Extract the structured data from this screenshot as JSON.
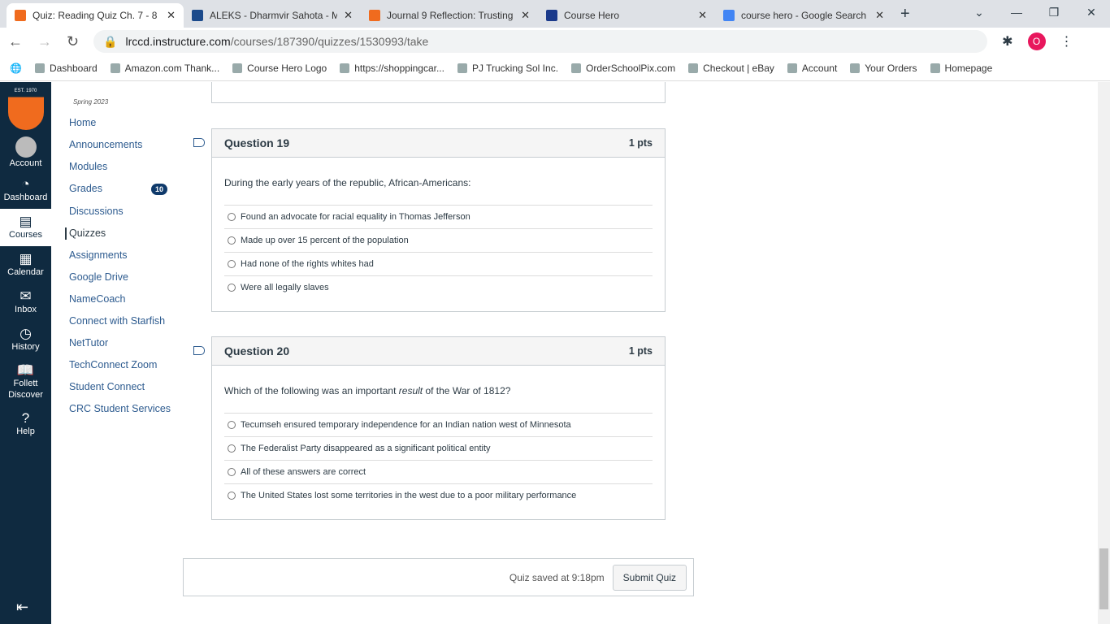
{
  "browser": {
    "tabs": [
      {
        "title": "Quiz: Reading Quiz Ch. 7 - 8",
        "color": "#f06b1e",
        "active": true
      },
      {
        "title": "ALEKS - Dharmvir Sahota - M",
        "color": "#1b4a8b"
      },
      {
        "title": "Journal 9 Reflection: Trusting",
        "color": "#f06b1e"
      },
      {
        "title": "Course Hero",
        "color": "#1b3a8b"
      },
      {
        "title": "course hero - Google Search",
        "color": "#4285f4"
      }
    ],
    "url_host": "lrccd.instructure.com",
    "url_path": "/courses/187390/quizzes/1530993/take",
    "profile": "O",
    "bookmarks": [
      "Dashboard",
      "Amazon.com Thank...",
      "Course Hero Logo",
      "https://shoppingcar...",
      "PJ Trucking Sol Inc.",
      "OrderSchoolPix.com",
      "Checkout | eBay",
      "Account",
      "Your Orders",
      "Homepage"
    ]
  },
  "global_nav": {
    "logo_text": "EST. 1970",
    "items": [
      "Account",
      "Dashboard",
      "Courses",
      "Calendar",
      "Inbox",
      "History",
      "Follett Discover",
      "Help"
    ]
  },
  "course_nav": {
    "term": "Spring 2023",
    "items": [
      "Home",
      "Announcements",
      "Modules",
      "Grades",
      "Discussions",
      "Quizzes",
      "Assignments",
      "Google Drive",
      "NameCoach",
      "Connect with Starfish",
      "NetTutor",
      "TechConnect Zoom",
      "Student Connect",
      "CRC Student Services"
    ],
    "grades_badge": "10",
    "current": "Quizzes"
  },
  "questions": [
    {
      "title": "Question 19",
      "points": "1 pts",
      "text": "During the early years of the republic, African-Americans:",
      "answers": [
        "Found an advocate for racial equality in Thomas Jefferson",
        "Made up over 15 percent of the population",
        "Had none of the rights whites had",
        "Were all legally slaves"
      ]
    },
    {
      "title": "Question 20",
      "points": "1 pts",
      "text_before": "Which of the following was an important ",
      "text_em": "result",
      "text_after": " of the War of 1812?",
      "answers": [
        "Tecumseh ensured temporary independence for an Indian nation west of Minnesota",
        "The Federalist Party disappeared as a significant political entity",
        "All of these answers are correct",
        "The United States lost some territories in the west due to a poor military performance"
      ]
    }
  ],
  "footer": {
    "saved": "Quiz saved at 9:18pm",
    "submit": "Submit Quiz"
  }
}
